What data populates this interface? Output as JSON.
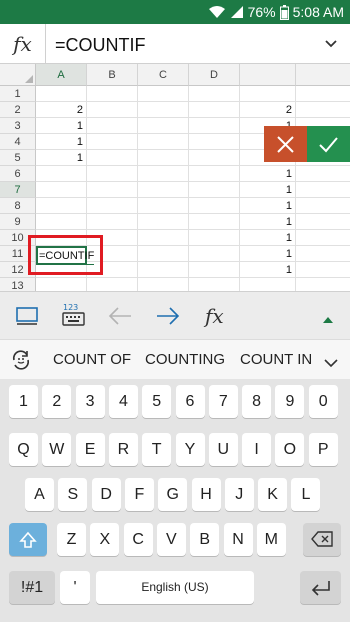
{
  "status_bar": {
    "battery": "76%",
    "time": "5:08 AM"
  },
  "formula_bar": {
    "fx_label": "fx",
    "formula": "=COUNTIF"
  },
  "grid": {
    "columns": [
      "A",
      "B",
      "C",
      "D"
    ],
    "rows": [
      "1",
      "2",
      "3",
      "4",
      "5",
      "6",
      "7",
      "8",
      "9",
      "10",
      "11",
      "12",
      "13"
    ],
    "col_a_values": [
      "",
      "2",
      "1",
      "1",
      "1",
      "",
      "",
      "",
      "",
      "",
      "",
      "",
      ""
    ],
    "col_e_values": [
      "",
      "2",
      "1",
      "1",
      "1",
      "1",
      "1",
      "1",
      "1",
      "1",
      "1",
      "1",
      ""
    ],
    "active_cell_text": "=COUNTIF"
  },
  "toolbar": {
    "fx_label": "fx",
    "keyboard_label": "123"
  },
  "suggestions": [
    "COUNT OF",
    "COUNTING",
    "COUNT IN"
  ],
  "keyboard": {
    "number_row": [
      "1",
      "2",
      "3",
      "4",
      "5",
      "6",
      "7",
      "8",
      "9",
      "0"
    ],
    "row1": [
      "Q",
      "W",
      "E",
      "R",
      "T",
      "Y",
      "U",
      "I",
      "O",
      "P"
    ],
    "row2": [
      "A",
      "S",
      "D",
      "F",
      "G",
      "H",
      "J",
      "K",
      "L"
    ],
    "row3": [
      "Z",
      "X",
      "C",
      "V",
      "B",
      "N",
      "M"
    ],
    "symbols_label": "!#1",
    "apostrophe": "'",
    "space_label": "English (US)"
  },
  "colors": {
    "status_bar": "#1d7a45",
    "cancel": "#c7502b",
    "confirm": "#24904f",
    "highlight_box": "#e01b22",
    "shift_key": "#6cb0dc"
  }
}
